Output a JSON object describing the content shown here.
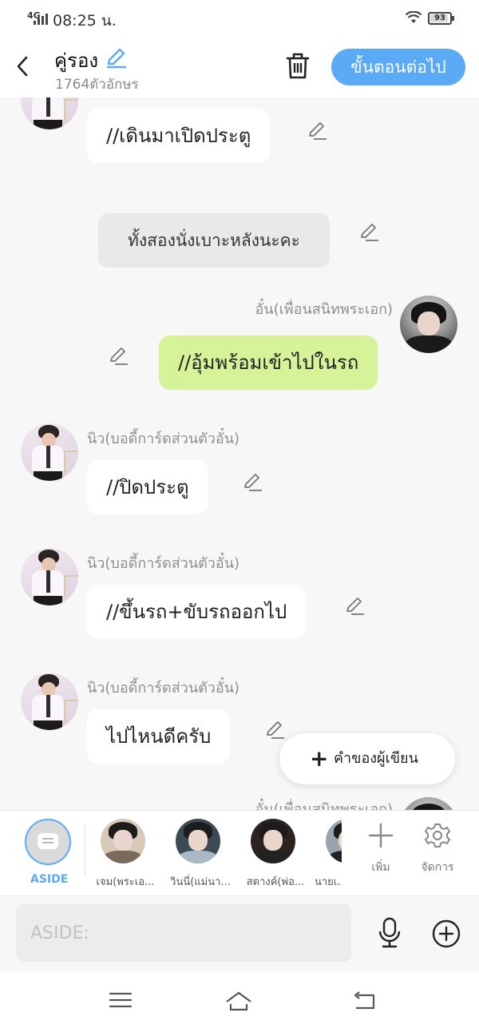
{
  "status_bar": {
    "network": "4G",
    "time": "08:25 น.",
    "battery": "93"
  },
  "header": {
    "title": "คู่รอง",
    "char_count": "1764ตัวอักษร",
    "next_label": "ขั้นตอนต่อไป"
  },
  "messages": {
    "m1": {
      "text": "//เดินมาเปิดประตู"
    },
    "narration": {
      "text": "ทั้งสองนั่งเบาะหลังนะคะ"
    },
    "m2": {
      "name": "อั๋น(เพื่อนสนิทพระเอก)",
      "text": "//อุ้มพร้อมเข้าไปในรถ"
    },
    "m3": {
      "name": "นิว(บอดี้การ์ดส่วนตัวอั๋น)",
      "text": "//ปิดประตู"
    },
    "m4": {
      "name": "นิว(บอดี้การ์ดส่วนตัวอั๋น)",
      "text": "//ขึ้นรถ+ขับรถออกไป"
    },
    "m5": {
      "name": "นิว(บอดี้การ์ดส่วนตัวอั๋น)",
      "text": "ไปไหนดีครับ"
    },
    "m6": {
      "name": "อั๋น(เพื่อนสนิทพระเอก)"
    }
  },
  "fab": {
    "label": "คำของผู้เขียน"
  },
  "character_bar": {
    "aside_label": "ASIDE",
    "characters": [
      {
        "label": "เจม(พระเอ..."
      },
      {
        "label": "วินนี่(แม่นา..."
      },
      {
        "label": "สตางค์(พ่อ..."
      },
      {
        "label": "นายเ..."
      }
    ],
    "add_label": "เพิ่ม",
    "manage_label": "จัดการ"
  },
  "input": {
    "placeholder": "ASIDE:"
  },
  "colors": {
    "accent": "#5aaaf6",
    "green_bubble": "#d7f39a",
    "background": "#f7f7f7"
  },
  "icons": [
    "back-icon",
    "pencil-icon",
    "trash-icon",
    "plus-icon",
    "gear-icon",
    "microphone-icon",
    "add-circle-icon",
    "menu-icon",
    "home-icon",
    "return-icon"
  ]
}
